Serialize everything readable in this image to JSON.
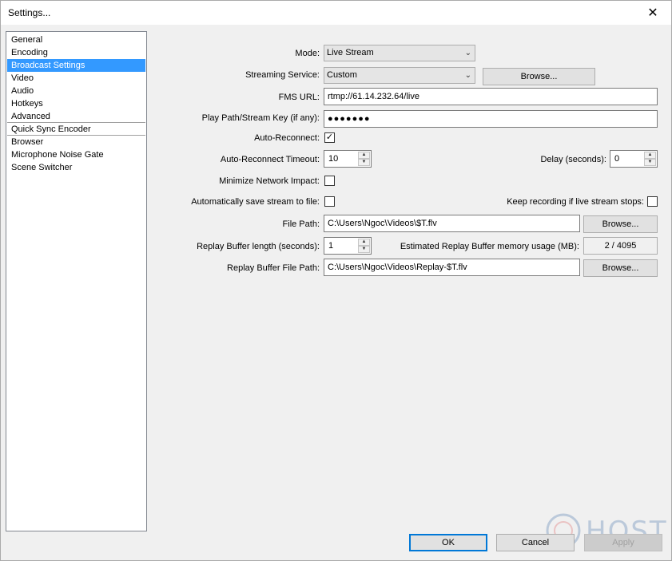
{
  "window": {
    "title": "Settings..."
  },
  "sidebar": {
    "items": [
      {
        "label": "General",
        "selected": false
      },
      {
        "label": "Encoding",
        "selected": false
      },
      {
        "label": "Broadcast Settings",
        "selected": true
      },
      {
        "label": "Video",
        "selected": false
      },
      {
        "label": "Audio",
        "selected": false
      },
      {
        "label": "Hotkeys",
        "selected": false
      },
      {
        "label": "Advanced",
        "selected": false
      },
      {
        "label": "Quick Sync Encoder",
        "selected": false
      },
      {
        "label": "Browser",
        "selected": false
      },
      {
        "label": "Microphone Noise Gate",
        "selected": false
      },
      {
        "label": "Scene Switcher",
        "selected": false
      }
    ]
  },
  "form": {
    "mode": {
      "label": "Mode:",
      "value": "Live Stream"
    },
    "service": {
      "label": "Streaming Service:",
      "value": "Custom",
      "browse_label": "Browse..."
    },
    "fms_url": {
      "label": "FMS URL:",
      "value": "rtmp://61.14.232.64/live"
    },
    "stream_key": {
      "label": "Play Path/Stream Key (if any):",
      "value": "●●●●●●●"
    },
    "auto_reconnect": {
      "label": "Auto-Reconnect:",
      "checked": true,
      "mark": "✓"
    },
    "reconnect_timeout": {
      "label": "Auto-Reconnect Timeout:",
      "value": "10"
    },
    "delay": {
      "label": "Delay (seconds):",
      "value": "0"
    },
    "minimize_impact": {
      "label": "Minimize Network Impact:",
      "checked": false
    },
    "auto_save": {
      "label": "Automatically save stream to file:",
      "checked": false
    },
    "keep_recording": {
      "label": "Keep recording if live stream stops:",
      "checked": false
    },
    "file_path": {
      "label": "File Path:",
      "value": "C:\\Users\\Ngoc\\Videos\\$T.flv",
      "browse_label": "Browse..."
    },
    "replay_length": {
      "label": "Replay Buffer length (seconds):",
      "value": "1"
    },
    "replay_memory": {
      "label": "Estimated Replay Buffer memory usage (MB):",
      "value": "2 / 4095"
    },
    "replay_path": {
      "label": "Replay Buffer File Path:",
      "value": "C:\\Users\\Ngoc\\Videos\\Replay-$T.flv",
      "browse_label": "Browse..."
    }
  },
  "footer": {
    "ok_label": "OK",
    "cancel_label": "Cancel",
    "apply_label": "Apply"
  },
  "watermark": {
    "text": "HOST"
  },
  "colors": {
    "selection": "#3399ff",
    "default_button_border": "#0078d7"
  }
}
